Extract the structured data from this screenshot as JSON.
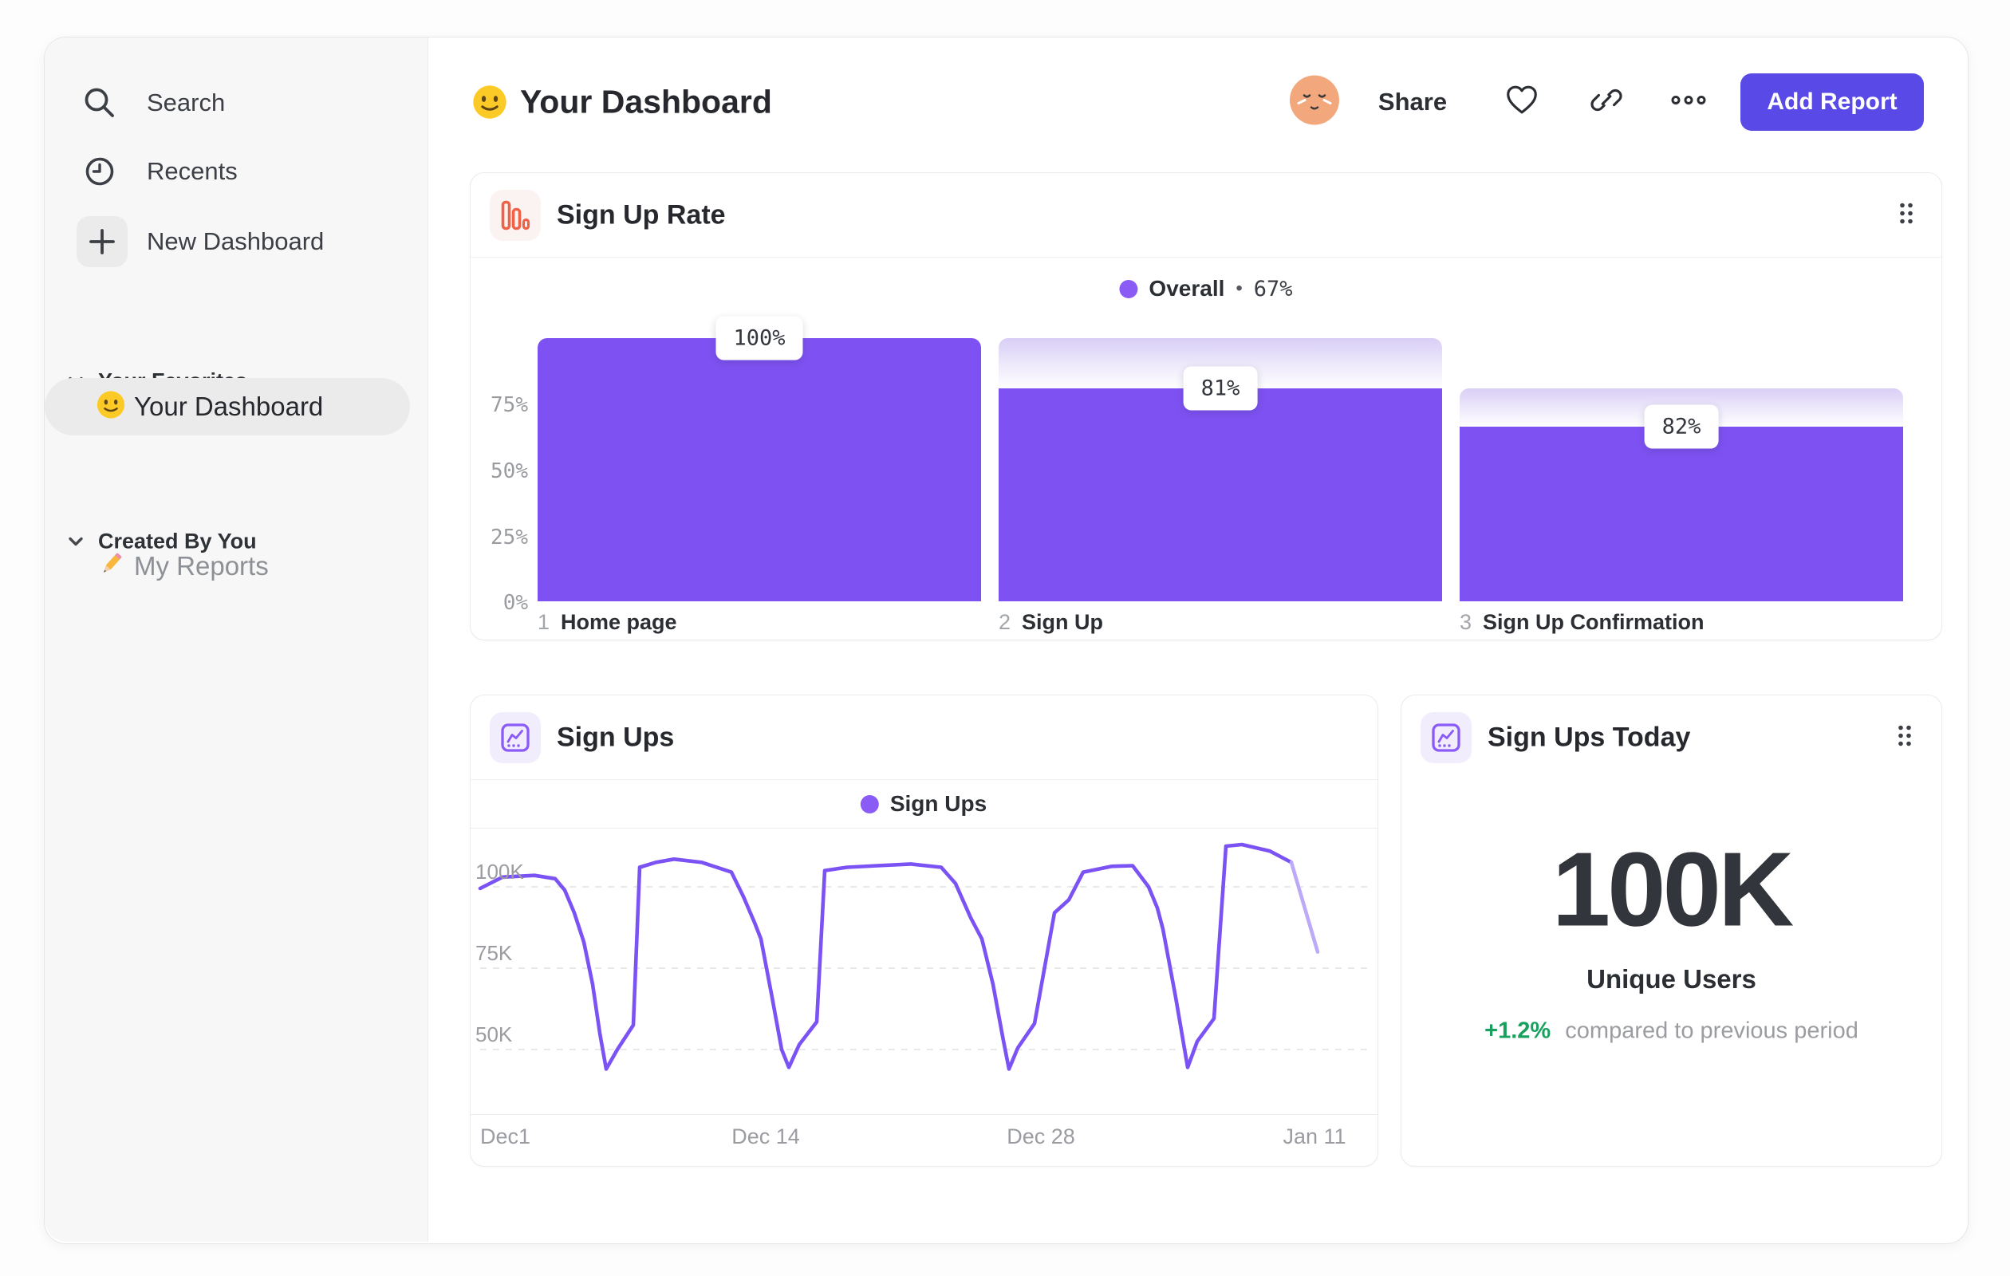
{
  "header": {
    "title": "Your Dashboard",
    "share_label": "Share",
    "add_report_label": "Add Report"
  },
  "sidebar": {
    "nav": [
      {
        "label": "Search",
        "icon": "search-icon"
      },
      {
        "label": "Recents",
        "icon": "clock-icon"
      },
      {
        "label": "New Dashboard",
        "icon": "plus-icon"
      }
    ],
    "sections": [
      {
        "label": "Your Favorites",
        "items": [
          {
            "label": "Your Dashboard",
            "icon": "smiley-emoji",
            "selected": true
          }
        ]
      },
      {
        "label": "Created By You",
        "items": [
          {
            "label": "My Reports",
            "icon": "pencil-emoji",
            "selected": false
          }
        ]
      }
    ]
  },
  "cards": {
    "signup_rate": {
      "title": "Sign Up Rate",
      "legend_label": "Overall",
      "legend_sep": "•",
      "legend_value": "67%",
      "y_ticks": [
        "75%",
        "50%",
        "25%",
        "0%"
      ],
      "steps": [
        {
          "num": "1",
          "name": "Home page",
          "value": "100%"
        },
        {
          "num": "2",
          "name": "Sign Up",
          "value": "81%"
        },
        {
          "num": "3",
          "name": "Sign Up Confirmation",
          "value": "82%"
        }
      ]
    },
    "signups": {
      "title": "Sign Ups",
      "legend_label": "Sign Ups",
      "y_ticks": [
        "100K",
        "75K",
        "50K"
      ],
      "x_ticks": [
        "Dec1",
        "Dec 14",
        "Dec 28",
        "Jan 11"
      ]
    },
    "signups_today": {
      "title": "Sign Ups Today",
      "value": "100K",
      "label": "Unique Users",
      "delta": "+1.2%",
      "delta_note": "compared to previous period"
    }
  },
  "colors": {
    "bar_purple": "#7e52f2",
    "line_purple": "#7b52f3",
    "line_tail": "#bcaaf8",
    "legend_dot": "#8a5cf5",
    "funnel_icon_orange": "#ee6247",
    "chart_icon_purple": "#8a5cf5",
    "button_indigo": "#5949e6",
    "delta_green": "#17a05e"
  },
  "chart_data": [
    {
      "type": "bar",
      "subtype": "funnel",
      "title": "Sign Up Rate",
      "categories": [
        "Home page",
        "Sign Up",
        "Sign Up Confirmation"
      ],
      "values": [
        100,
        81,
        82
      ],
      "value_meaning": "step conversion %",
      "overall_pct": 67,
      "absolute_pct": [
        100,
        81,
        66.5
      ],
      "ylim": [
        0,
        100
      ],
      "y_ticks": [
        75,
        50,
        25,
        0
      ],
      "bar_color": "#7e52f2",
      "legend": "Overall • 67%"
    },
    {
      "type": "line",
      "title": "Sign Ups",
      "x_ticks": [
        "Dec1",
        "Dec 14",
        "Dec 28",
        "Jan 11"
      ],
      "y_ticks": [
        100,
        75,
        50
      ],
      "y_unit": "K",
      "ylim": [
        40,
        115
      ],
      "grid": "dashed horizontal",
      "legend_position": "top-center",
      "series": [
        {
          "name": "Sign Ups",
          "color": "#7b52f3",
          "points": [
            [
              12,
              99.5
            ],
            [
              40,
              103
            ],
            [
              80,
              103.5
            ],
            [
              106,
              102.5
            ],
            [
              118,
              99
            ],
            [
              130,
              92
            ],
            [
              142,
              83
            ],
            [
              153,
              70
            ],
            [
              162,
              55
            ],
            [
              170,
              44
            ],
            [
              184,
              50
            ],
            [
              204,
              57.5
            ],
            [
              212,
              106
            ],
            [
              232,
              107.5
            ],
            [
              255,
              108.5
            ],
            [
              290,
              107.5
            ],
            [
              327,
              104.5
            ],
            [
              342,
              97
            ],
            [
              356,
              89
            ],
            [
              364,
              84
            ],
            [
              378,
              66
            ],
            [
              390,
              50
            ],
            [
              399,
              44.5
            ],
            [
              412,
              51.5
            ],
            [
              434,
              58.5
            ],
            [
              444,
              105
            ],
            [
              472,
              106
            ],
            [
              510,
              106.5
            ],
            [
              552,
              107
            ],
            [
              590,
              106
            ],
            [
              608,
              101
            ],
            [
              627,
              90.5
            ],
            [
              641,
              84
            ],
            [
              655,
              70
            ],
            [
              667,
              54
            ],
            [
              675,
              44
            ],
            [
              686,
              50.5
            ],
            [
              707,
              58
            ],
            [
              732,
              92
            ],
            [
              750,
              96
            ],
            [
              768,
              104.5
            ],
            [
              804,
              106.3
            ],
            [
              830,
              106.5
            ],
            [
              850,
              100
            ],
            [
              861,
              93.5
            ],
            [
              868,
              87
            ],
            [
              884,
              66
            ],
            [
              899,
              44.5
            ],
            [
              911,
              52.5
            ],
            [
              932,
              59.5
            ],
            [
              947,
              112.5
            ],
            [
              967,
              113
            ],
            [
              1002,
              111
            ],
            [
              1029,
              107.5
            ]
          ]
        }
      ],
      "incomplete_tail": {
        "color": "#bcaaf8",
        "points": [
          [
            1029,
            107.5
          ],
          [
            1062,
            80
          ]
        ]
      }
    },
    {
      "type": "stat",
      "title": "Sign Ups Today",
      "value": "100K",
      "label": "Unique Users",
      "delta_pct": 1.2,
      "delta_text": "+1.2%",
      "note": "compared to previous period"
    }
  ]
}
